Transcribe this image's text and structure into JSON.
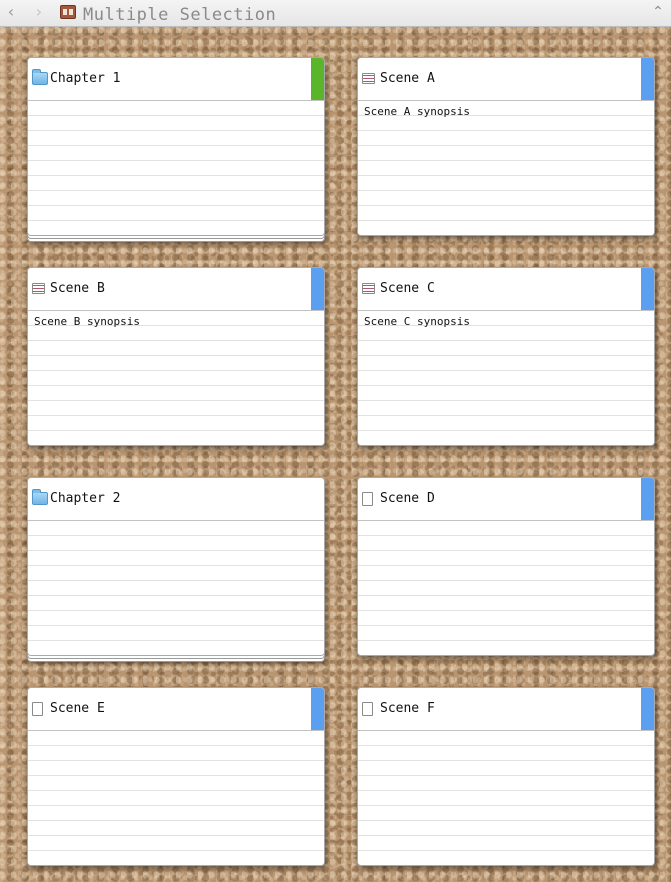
{
  "window": {
    "title": "Multiple Selection",
    "back_icon": "‹",
    "forward_icon": "›",
    "collapse_icon": "⌃",
    "document_icon": "corkboard-icon"
  },
  "colors": {
    "chapter_label": "#5ab52a",
    "scene_label": "#5b9ff0",
    "corkboard": "#b99671"
  },
  "cards": [
    {
      "title": "Chapter 1",
      "synopsis": "",
      "icon": "folder-icon",
      "label_color": "#5ab52a"
    },
    {
      "title": "Scene A",
      "synopsis": "Scene A synopsis",
      "icon": "text-document-icon",
      "label_color": "#5b9ff0"
    },
    {
      "title": "Scene B",
      "synopsis": "Scene B synopsis",
      "icon": "text-document-icon",
      "label_color": "#5b9ff0"
    },
    {
      "title": "Scene C",
      "synopsis": "Scene C synopsis",
      "icon": "text-document-icon",
      "label_color": "#5b9ff0"
    },
    {
      "title": "Chapter 2",
      "synopsis": "",
      "icon": "folder-icon",
      "label_color": null
    },
    {
      "title": "Scene D",
      "synopsis": "",
      "icon": "blank-document-icon",
      "label_color": "#5b9ff0"
    },
    {
      "title": "Scene E",
      "synopsis": "",
      "icon": "blank-document-icon",
      "label_color": "#5b9ff0"
    },
    {
      "title": "Scene F",
      "synopsis": "",
      "icon": "blank-document-icon",
      "label_color": "#5b9ff0"
    }
  ]
}
